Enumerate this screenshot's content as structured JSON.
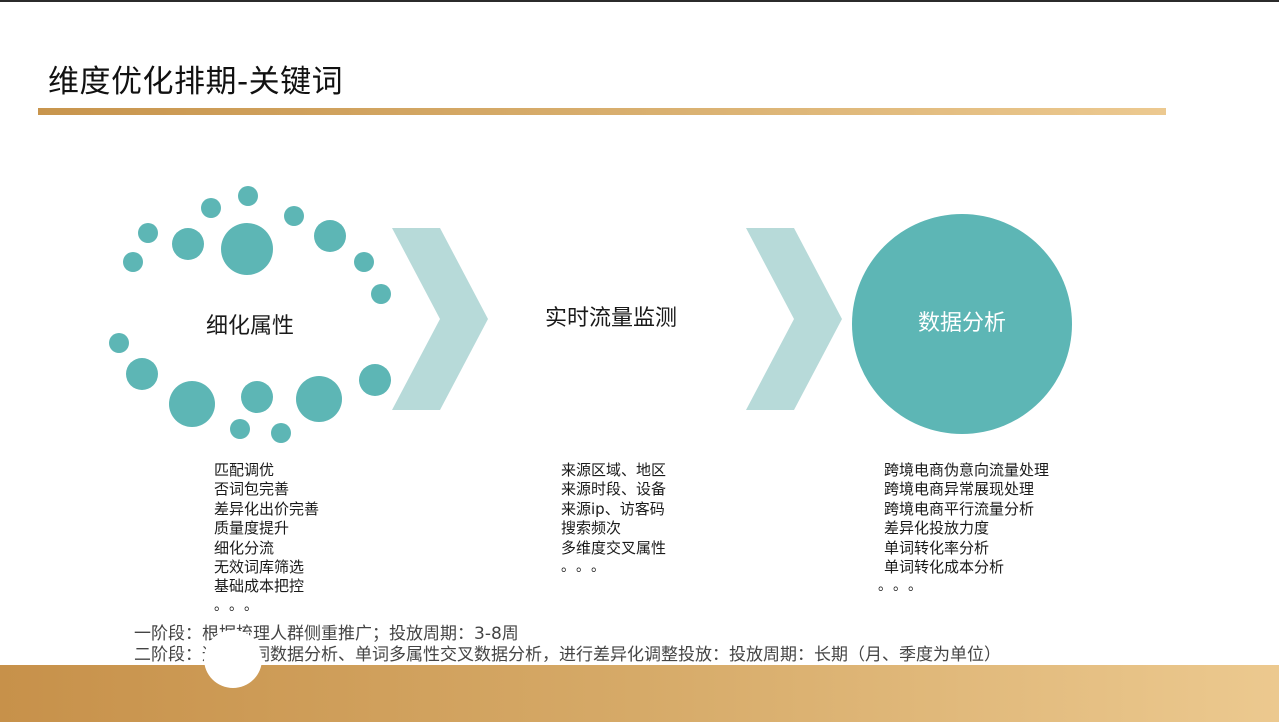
{
  "title": "维度优化排期-关键词",
  "stages": [
    {
      "label": "细化属性"
    },
    {
      "label": "实时流量监测"
    },
    {
      "label": "数据分析"
    }
  ],
  "lists": {
    "attributes": [
      "匹配调优",
      "否词包完善",
      "差异化出价完善",
      "质量度提升",
      "细化分流",
      "无效词库筛选",
      "基础成本把控"
    ],
    "monitoring": [
      "来源区域、地区",
      "来源时段、设备",
      "来源ip、访客码",
      "搜索频次",
      "多维度交叉属性"
    ],
    "analysis": [
      "跨境电商伪意向流量处理",
      "跨境电商异常展现处理",
      "跨境电商平行流量分析",
      "差异化投放力度",
      "单词转化率分析",
      "单词转化成本分析"
    ]
  },
  "ellipsis": "。。。",
  "phases": [
    "一阶段：根据梳理人群侧重推广；投放周期：3-8周",
    "二阶段：通过单词数据分析、单词多属性交叉数据分析，进行差异化调整投放：投放周期：长期（月、季度为单位）"
  ],
  "colors": {
    "teal": "#5db6b5",
    "chevron": "#b7dad9",
    "gold": "#c8954d",
    "gold_light": "#ecc990"
  },
  "icons": {
    "chevron": "chevron-right-icon"
  }
}
